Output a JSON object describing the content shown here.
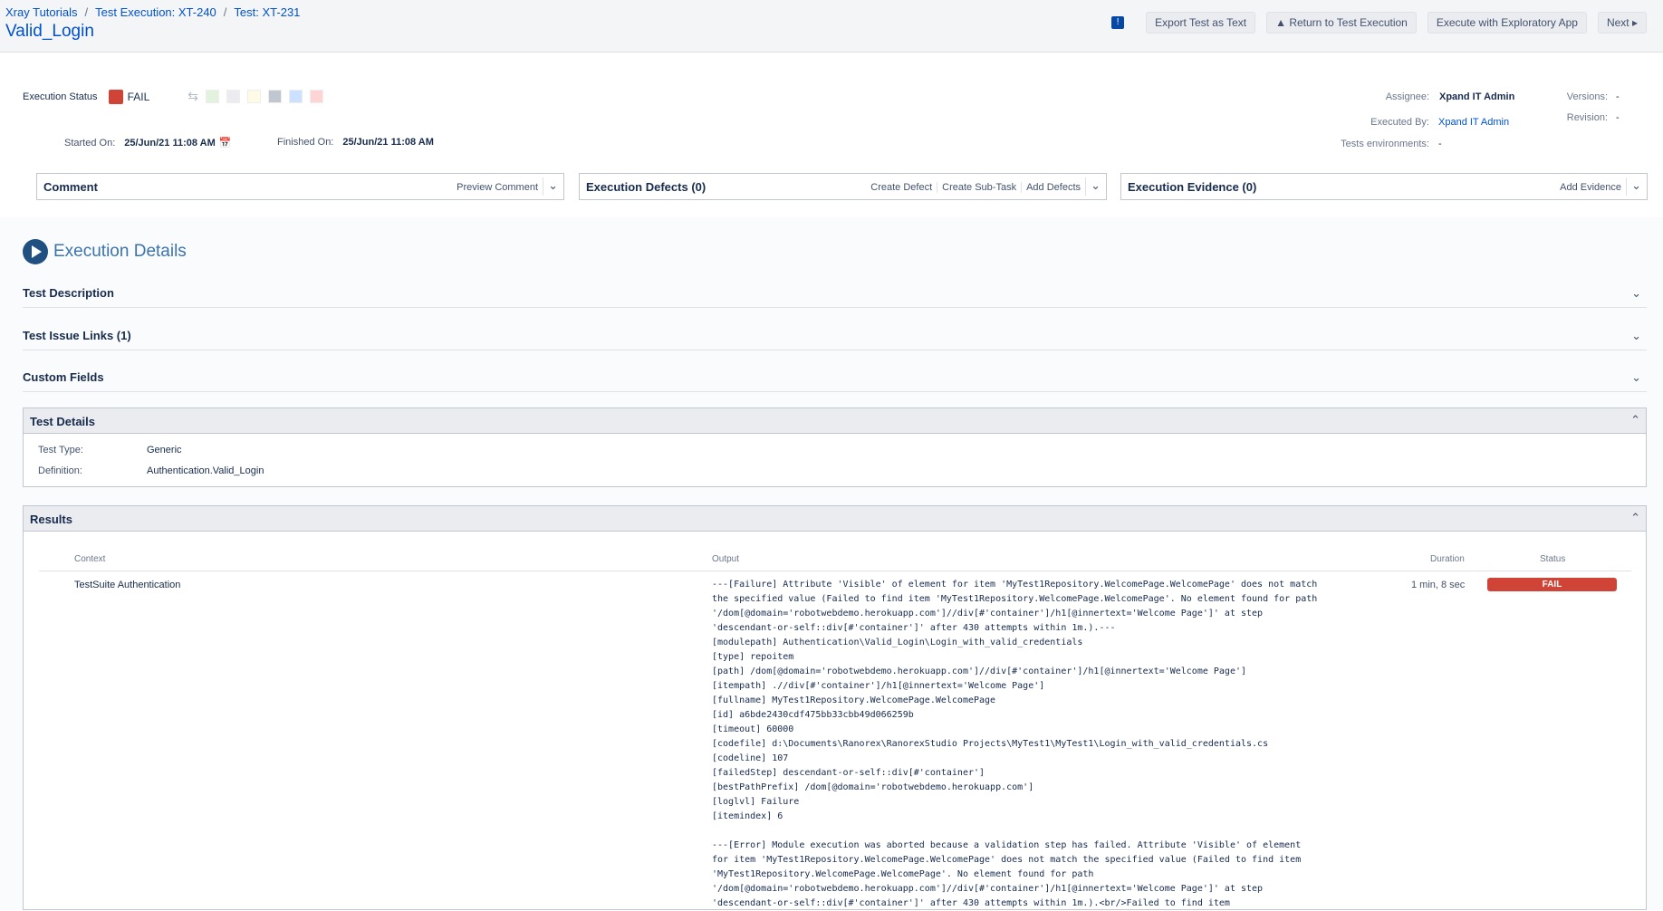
{
  "breadcrumb": {
    "project": "Xray Tutorials",
    "execution": "Test Execution: XT-240",
    "test": "Test: XT-231"
  },
  "page_title": "Valid_Login",
  "top_actions": {
    "export": "Export Test as Text",
    "return": "Return to Test Execution",
    "exploratory": "Execute with Exploratory App",
    "next": "Next"
  },
  "execution_status": {
    "label": "Execution Status",
    "value": "FAIL",
    "color": "#d04437",
    "swatches": [
      "#e3f1df",
      "#ebecf0",
      "#fffae6",
      "#c1c7d0",
      "#cce0ff",
      "#ffd4d4"
    ]
  },
  "dates": {
    "started_label": "Started On:",
    "started_value": "25/Jun/21 11:08 AM",
    "finished_label": "Finished On:",
    "finished_value": "25/Jun/21 11:08 AM"
  },
  "info": {
    "assignee_label": "Assignee:",
    "assignee_value": "Xpand IT Admin",
    "executed_by_label": "Executed By:",
    "executed_by_value": "Xpand IT Admin",
    "envs_label": "Tests environments:",
    "envs_value": "-",
    "versions_label": "Versions:",
    "versions_value": "-",
    "revision_label": "Revision:",
    "revision_value": "-"
  },
  "panels": {
    "comment": {
      "title": "Comment",
      "action": "Preview Comment"
    },
    "defects": {
      "title": "Execution Defects (0)",
      "action1": "Create Defect",
      "action2": "Create Sub-Task",
      "action3": "Add Defects"
    },
    "evidence": {
      "title": "Execution Evidence (0)",
      "action": "Add Evidence"
    }
  },
  "execution_details": {
    "title": "Execution Details",
    "sections": {
      "description": "Test Description",
      "links": "Test Issue Links (1)",
      "custom_fields": "Custom Fields"
    }
  },
  "test_details": {
    "title": "Test Details",
    "type_label": "Test Type:",
    "type_value": "Generic",
    "definition_label": "Definition:",
    "definition_value": "Authentication.Valid_Login"
  },
  "results": {
    "title": "Results",
    "columns": {
      "context": "Context",
      "output": "Output",
      "duration": "Duration",
      "status": "Status"
    },
    "row": {
      "context": "TestSuite Authentication",
      "duration": "1 min, 8 sec",
      "status": "FAIL",
      "output": "---[Failure] Attribute 'Visible' of element for item 'MyTest1Repository.WelcomePage.WelcomePage' does not match\nthe specified value (Failed to find item 'MyTest1Repository.WelcomePage.WelcomePage'. No element found for path\n'/dom[@domain='robotwebdemo.herokuapp.com']//div[#'container']/h1[@innertext='Welcome Page']' at step\n'descendant-or-self::div[#'container']' after 430 attempts within 1m.).---\n[modulepath] Authentication\\Valid_Login\\Login_with_valid_credentials\n[type] repoitem\n[path] /dom[@domain='robotwebdemo.herokuapp.com']//div[#'container']/h1[@innertext='Welcome Page']\n[itempath] .//div[#'container']/h1[@innertext='Welcome Page']\n[fullname] MyTest1Repository.WelcomePage.WelcomePage\n[id] a6bde2430cdf475bb33cbb49d066259b\n[timeout] 60000\n[codefile] d:\\Documents\\Ranorex\\RanorexStudio Projects\\MyTest1\\MyTest1\\Login_with_valid_credentials.cs\n[codeline] 107\n[failedStep] descendant-or-self::div[#'container']\n[bestPathPrefix] /dom[@domain='robotwebdemo.herokuapp.com']\n[loglvl] Failure\n[itemindex] 6\n\n---[Error] Module execution was aborted because a validation step has failed. Attribute 'Visible' of element\nfor item 'MyTest1Repository.WelcomePage.WelcomePage' does not match the specified value (Failed to find item\n'MyTest1Repository.WelcomePage.WelcomePage'. No element found for path\n'/dom[@domain='robotwebdemo.herokuapp.com']//div[#'container']/h1[@innertext='Welcome Page']' at step\n'descendant-or-self::div[#'container']' after 430 attempts within 1m.).<br/>Failed to find item"
    }
  }
}
